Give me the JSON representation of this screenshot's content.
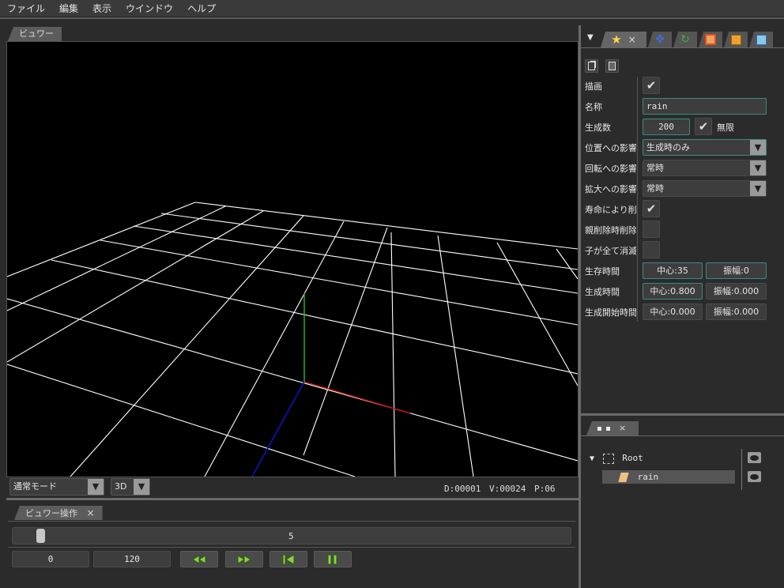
{
  "menubar": {
    "items": [
      "ファイル",
      "編集",
      "表示",
      "ウインドウ",
      "ヘルプ"
    ]
  },
  "viewer": {
    "tab_label": "ビュワー",
    "mode_select": "通常モード",
    "dim_select": "3D",
    "stats": {
      "d": "D:00001",
      "v": "V:00024",
      "p": "P:06"
    }
  },
  "viewer_ops": {
    "tab_label": "ビュワー操作",
    "slider_value": "5",
    "start_frame": "0",
    "end_frame": "120"
  },
  "properties": {
    "tab_close": "×",
    "rows": {
      "draw": {
        "label": "描画",
        "checked": true
      },
      "name": {
        "label": "名称",
        "value": "rain"
      },
      "count": {
        "label": "生成数",
        "value": "200",
        "infinite_label": "無限",
        "infinite_checked": true
      },
      "pos_influence": {
        "label": "位置への影響",
        "value": "生成時のみ"
      },
      "rot_influence": {
        "label": "回転への影響",
        "value": "常時"
      },
      "scale_influence": {
        "label": "拡大への影響",
        "value": "常時"
      },
      "remove_on_life": {
        "label": "寿命により削除",
        "checked": true
      },
      "remove_on_parent": {
        "label": "親削除時削除",
        "checked": false
      },
      "remove_on_children": {
        "label": "子が全て消滅",
        "checked": false
      },
      "life": {
        "label": "生存時間",
        "center": "中心:35",
        "amplitude": "振幅:0"
      },
      "gen_time": {
        "label": "生成時間",
        "center": "中心:0.800",
        "amplitude": "振幅:0.000"
      },
      "gen_start": {
        "label": "生成開始時間",
        "center": "中心:0.000",
        "amplitude": "振幅:0.000"
      }
    }
  },
  "node_tree": {
    "tab_close": "×",
    "root_label": "Root",
    "child_label": "rain"
  },
  "colors": {
    "accent": "#3a8a86",
    "axis_x": "#d01010",
    "axis_y": "#20c020",
    "axis_z": "#1010c0"
  }
}
